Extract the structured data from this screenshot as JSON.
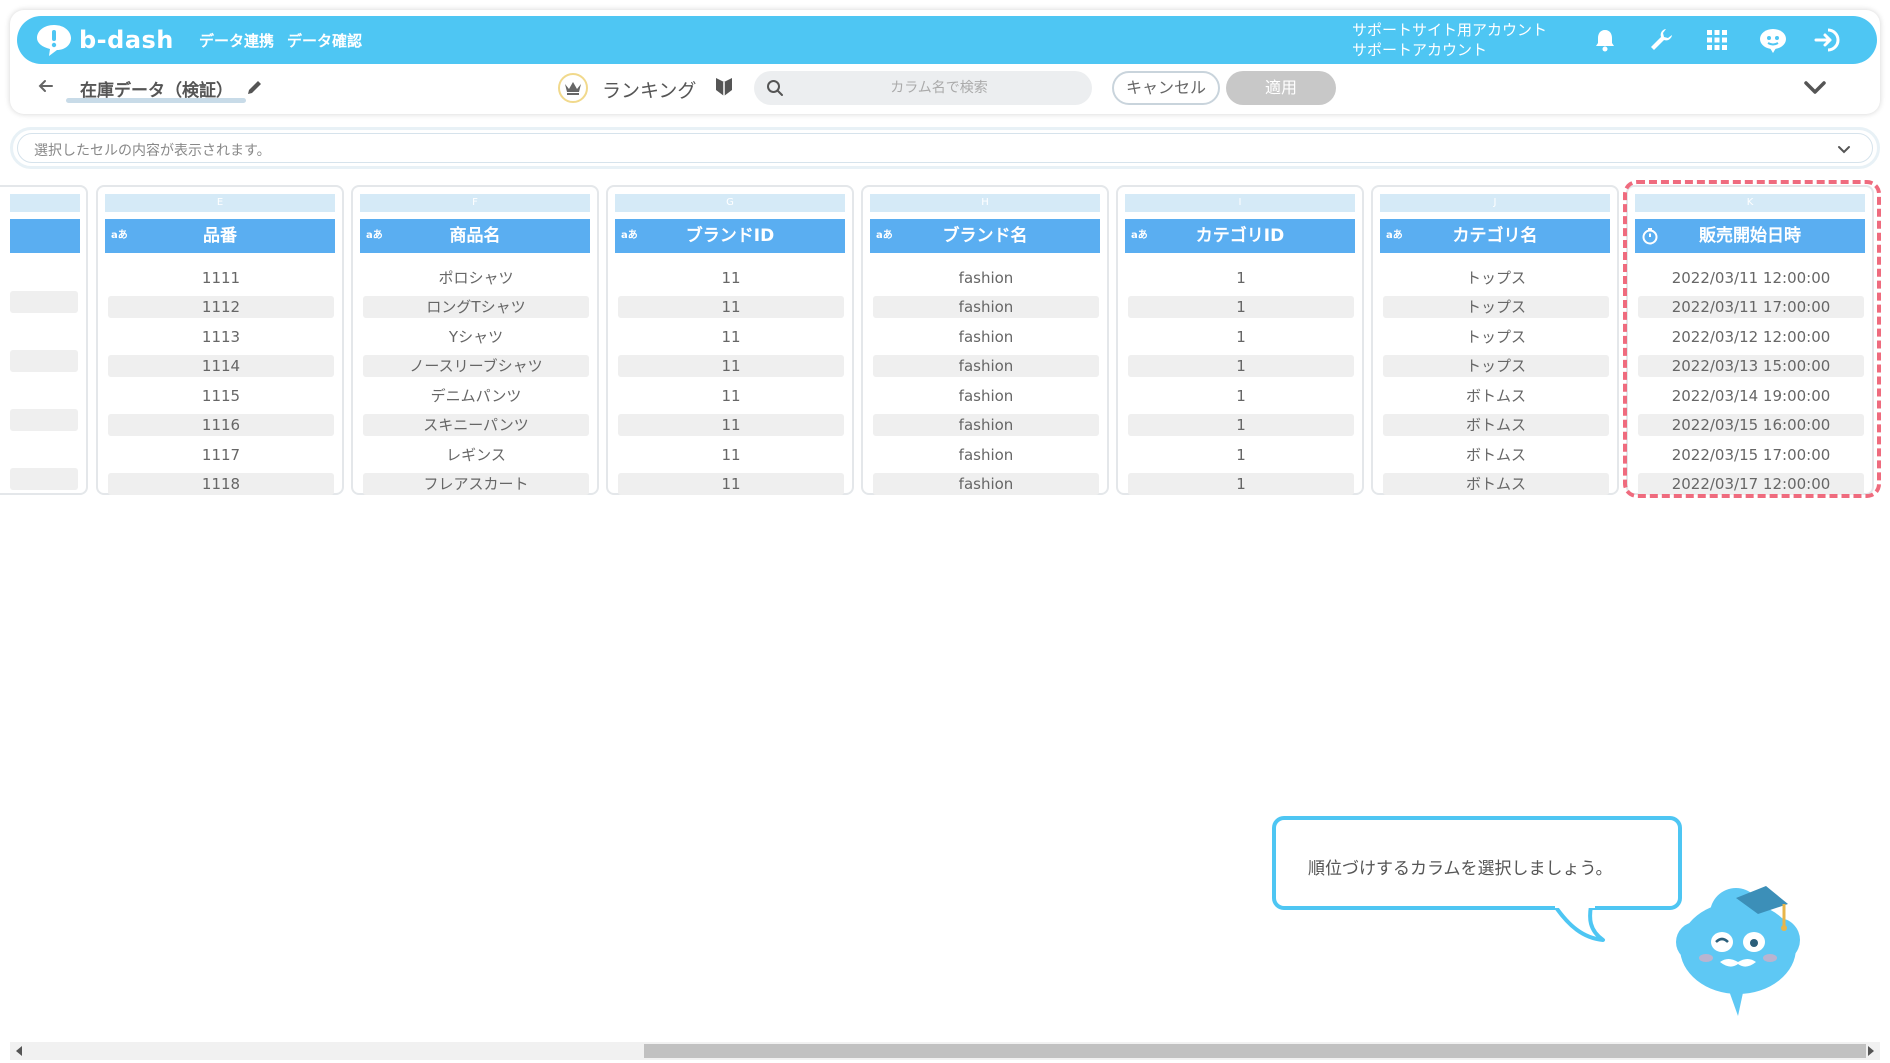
{
  "app": {
    "logo_text": "b-dash"
  },
  "nav": {
    "links": [
      "データ連携",
      "データ確認"
    ],
    "account_line1": "サポートサイト用アカウント",
    "account_line2": "サポートアカウント"
  },
  "subbar": {
    "dataset_name": "在庫データ（検証）",
    "mode_label": "ランキング",
    "search_placeholder": "カラム名で検索",
    "cancel_label": "キャンセル",
    "apply_label": "適用"
  },
  "cellbar": {
    "text": "選択したセルの内容が表示されます。"
  },
  "columns": [
    {
      "letter": "E",
      "name": "品番",
      "type": "aあ",
      "values": [
        "1111",
        "1112",
        "1113",
        "1114",
        "1115",
        "1116",
        "1117",
        "1118"
      ]
    },
    {
      "letter": "F",
      "name": "商品名",
      "type": "aあ",
      "values": [
        "ポロシャツ",
        "ロングTシャツ",
        "Yシャツ",
        "ノースリーブシャツ",
        "デニムパンツ",
        "スキニーパンツ",
        "レギンス",
        "フレアスカート"
      ]
    },
    {
      "letter": "G",
      "name": "ブランドID",
      "type": "aあ",
      "values": [
        "11",
        "11",
        "11",
        "11",
        "11",
        "11",
        "11",
        "11"
      ]
    },
    {
      "letter": "H",
      "name": "ブランド名",
      "type": "aあ",
      "values": [
        "fashion",
        "fashion",
        "fashion",
        "fashion",
        "fashion",
        "fashion",
        "fashion",
        "fashion"
      ]
    },
    {
      "letter": "I",
      "name": "カテゴリID",
      "type": "aあ",
      "values": [
        "1",
        "1",
        "1",
        "1",
        "1",
        "1",
        "1",
        "1"
      ]
    },
    {
      "letter": "J",
      "name": "カテゴリ名",
      "type": "aあ",
      "values": [
        "トップス",
        "トップス",
        "トップス",
        "トップス",
        "ボトムス",
        "ボトムス",
        "ボトムス",
        "ボトムス"
      ]
    },
    {
      "letter": "K",
      "name": "販売開始日時",
      "type": "datetime",
      "values": [
        "2022/03/11 12:00:00",
        "2022/03/11 17:00:00",
        "2022/03/12 12:00:00",
        "2022/03/13 15:00:00",
        "2022/03/14 19:00:00",
        "2022/03/15 16:00:00",
        "2022/03/15 17:00:00",
        "2022/03/17 12:00:00"
      ]
    }
  ],
  "tutorial": {
    "message": "順位づけするカラムを選択しましょう。"
  },
  "colors": {
    "nav": "#4ec6f3",
    "column_header": "#5aaef1",
    "highlight": "#ef6b7e",
    "apply_disabled": "#c8c8c8"
  }
}
